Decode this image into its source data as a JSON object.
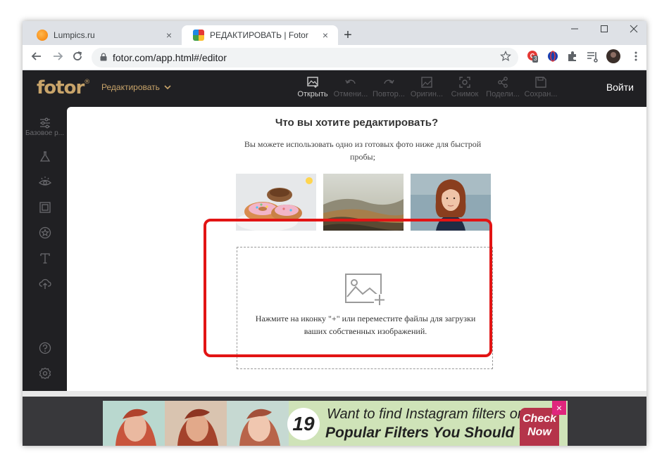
{
  "browser": {
    "tabs": [
      {
        "title": "Lumpics.ru",
        "favicon": "lumpics-favicon-icon",
        "active": false
      },
      {
        "title": "РЕДАКТИРОВАТЬ | Fotor",
        "favicon": "fotor-favicon-icon",
        "active": true
      }
    ],
    "tab_close": "×",
    "new_tab": "+",
    "url": "fotor.com/app.html#/editor",
    "extension_badge": "3"
  },
  "fotor": {
    "logo": "fotor",
    "logo_mark": "®",
    "edit_menu": "Редактировать",
    "tools": [
      {
        "label": "Открыть",
        "icon": "open-image-icon",
        "enabled": true
      },
      {
        "label": "Отмени...",
        "icon": "undo-icon",
        "enabled": false
      },
      {
        "label": "Повтор...",
        "icon": "redo-icon",
        "enabled": false
      },
      {
        "label": "Оригин...",
        "icon": "original-icon",
        "enabled": false
      },
      {
        "label": "Снимок",
        "icon": "snapshot-icon",
        "enabled": false
      },
      {
        "label": "Подели...",
        "icon": "share-icon",
        "enabled": false
      },
      {
        "label": "Сохран...",
        "icon": "save-icon",
        "enabled": false
      }
    ],
    "login": "Войти",
    "sidebar": {
      "first_label": "Базовое р..."
    }
  },
  "panel": {
    "heading": "Что вы хотите редактировать?",
    "subtext": "Вы можете использовать одно из готовых фото ниже для быстрой пробы;",
    "drop_text": "Нажмите на иконку \"+\" или переместите файлы для загрузки ваших собственных изображений."
  },
  "ad": {
    "number": "19",
    "line1": "Want to find Instagram filters online?",
    "line2": "Popular Filters You Should Try",
    "cta_line1": "Check",
    "cta_line2": "Now",
    "close": "×"
  },
  "colors": {
    "accent_gold": "#c8a46a",
    "dark_bg": "#202023",
    "highlight_red": "#e21414"
  }
}
